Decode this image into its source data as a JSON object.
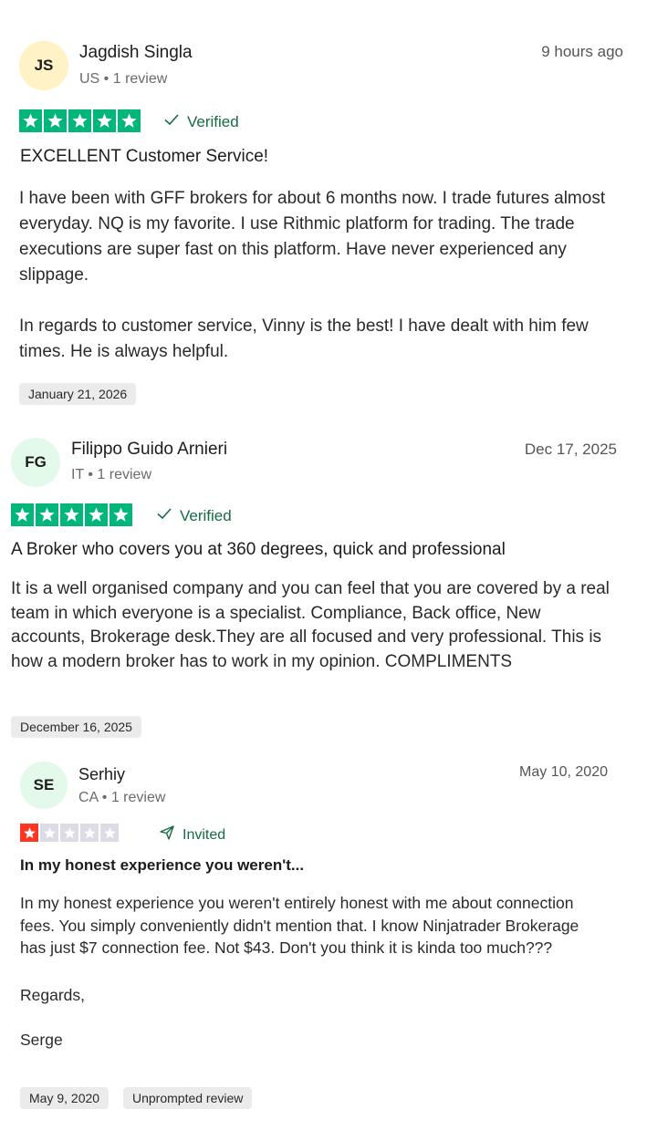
{
  "colors": {
    "star_green": "#00b67a",
    "star_red": "#ff3722",
    "star_empty": "#dcdce6",
    "verified_green": "#146c43"
  },
  "reviews": [
    {
      "initials": "JS",
      "name": "Jagdish Singla",
      "meta": "US • 1 review",
      "time": "9 hours ago",
      "rating": 5,
      "badge": "Verified",
      "badge_icon": "check-icon",
      "title": "EXCELLENT Customer Service!",
      "body": [
        "I have been with GFF brokers for about 6 months now. I trade futures almost everyday. NQ is my favorite. I use Rithmic platform for trading. The trade executions are super fast on this platform. Have never experienced any slippage.",
        "In regards to customer service, Vinny is the best! I have dealt with him few times. He is always helpful."
      ],
      "experience_date": "January 21, 2026"
    },
    {
      "initials": "FG",
      "name": "Filippo Guido Arnieri",
      "meta": "IT • 1 review",
      "time": "Dec 17, 2025",
      "rating": 5,
      "badge": "Verified",
      "badge_icon": "check-icon",
      "title": "A Broker who covers you at 360 degrees, quick and professional",
      "body": [
        "It is a well organised company and you can feel that you are covered by a real team in which everyone is a specialist. Compliance, Back office, New accounts, Brokerage desk.They are all focused and very professional. This is how a modern broker has to work in my opinion. COMPLIMENTS"
      ],
      "experience_date": "December 16, 2025"
    },
    {
      "initials": "SE",
      "name": "Serhiy",
      "meta": "CA • 1 review",
      "time": "May 10, 2020",
      "rating": 1,
      "badge": "Invited",
      "badge_icon": "send-icon",
      "title": "In my honest experience you weren't...",
      "body": [
        "In my honest experience you weren't entirely honest with me about connection fees. You simply conveniently didn't mention that. I know Ninjatrader Brokerage has just $7 connection fee. Not $43. Don't you think it is kinda too much???",
        "Regards,",
        "Serge"
      ],
      "experience_date": "May 9, 2020",
      "extra_tag": "Unprompted review"
    }
  ]
}
